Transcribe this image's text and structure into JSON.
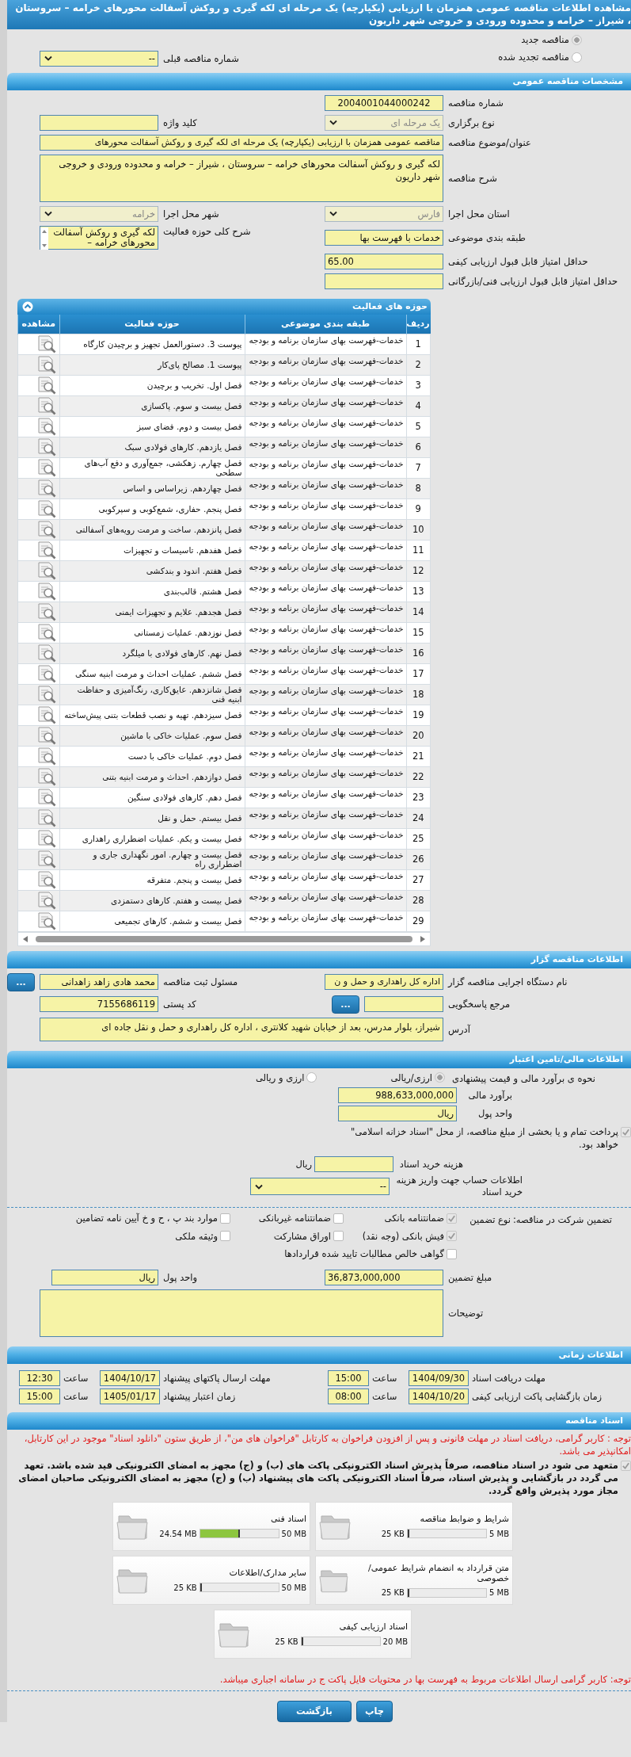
{
  "title": "مشاهده اطلاعات مناقصه عمومی همزمان با ارزیابی (یکپارچه) یک مرحله ای لکه گیری و روکش آسفالت محورهای خرامه – سروستان ، شیراز – خرامه و محدوده ورودی و خروجی شهر داریون",
  "tender_status": {
    "options": [
      {
        "label": "مناقصه جدید",
        "selected": true
      },
      {
        "label": "مناقصه تجدید شده",
        "selected": false
      }
    ],
    "previous_number": {
      "label": "شماره مناقصه قبلی",
      "value": "--",
      "disabled": false
    }
  },
  "general": {
    "heading": "مشخصات مناقصه عمومی",
    "tender_number": {
      "label": "شماره مناقصه",
      "value": "2004001044000242"
    },
    "holding_type": {
      "label": "نوع برگزاری",
      "value": "یک مرحله ای",
      "disabled": true
    },
    "keyword": {
      "label": "کلید واژه"
    },
    "subject": {
      "label": "عنوان/موضوع مناقصه",
      "value": "مناقصه عمومی همزمان با ارزیابی (یکپارچه) یک مرحله ای لکه گیری و روکش آسفالت محورهای"
    },
    "description": {
      "label": "شرح مناقصه",
      "value": "لکه گیری و روکش آسفالت محورهای خرامه – سروستان ، شیراز – خرامه و محدوده ورودی و خروجی شهر داریون"
    },
    "province": {
      "label": "استان محل اجرا",
      "value": "فارس",
      "disabled": true
    },
    "city": {
      "label": "شهر محل اجرا",
      "value": "خرامه",
      "disabled": true
    },
    "category": {
      "label": "طبقه بندی موضوعی",
      "value": "خدمات با فهرست بها"
    },
    "activity_scope": {
      "label": "شرح کلی حوزه فعالیت",
      "value": "لکه گیری و روکش آسفالت محورهای خرامه –"
    },
    "min_quality_score": {
      "label": "حداقل امتیاز قابل قبول ارزیابی کیفی",
      "value": "65.00"
    },
    "min_technical_score": {
      "label": "حداقل امتیاز قابل قبول ارزیابی فنی/بازرگانی"
    }
  },
  "activities": {
    "heading": "حوزه های فعالیت",
    "expanded": true,
    "columns": [
      "ردیف",
      "طبقه بندی موضوعی",
      "حوزه فعالیت",
      "مشاهده"
    ],
    "rows": [
      {
        "row": "1",
        "category": "خدمات-فهرست بهای سازمان برنامه و بودجه",
        "activity": "پیوست 3. دستورالعمل تجهیز و برچیدن کارگاه"
      },
      {
        "row": "2",
        "category": "خدمات-فهرست بهای سازمان برنامه و بودجه",
        "activity": "پیوست 1. مصالح پای‌کار"
      },
      {
        "row": "3",
        "category": "خدمات-فهرست بهای سازمان برنامه و بودجه",
        "activity": "فصل اول. تخریب و برچیدن"
      },
      {
        "row": "4",
        "category": "خدمات-فهرست بهای سازمان برنامه و بودجه",
        "activity": "فصل بیست و سوم. پاکسازی"
      },
      {
        "row": "5",
        "category": "خدمات-فهرست بهای سازمان برنامه و بودجه",
        "activity": "فصل بیست و دوم. فضای سبز"
      },
      {
        "row": "6",
        "category": "خدمات-فهرست بهای سازمان برنامه و بودجه",
        "activity": "فصل یازدهم. کارهای فولادی سبک"
      },
      {
        "row": "7",
        "category": "خدمات-فهرست بهای سازمان برنامه و بودجه",
        "activity": "فصل چهارم. زهکشی، جمع‌آوری و دفع آب‌های سطحی"
      },
      {
        "row": "8",
        "category": "خدمات-فهرست بهای سازمان برنامه و بودجه",
        "activity": "فصل چهاردهم. زیراساس و اساس"
      },
      {
        "row": "9",
        "category": "خدمات-فهرست بهای سازمان برنامه و بودجه",
        "activity": "فصل پنجم. حفاری، شمع‌کوبی و سپرکوبی"
      },
      {
        "row": "10",
        "category": "خدمات-فهرست بهای سازمان برنامه و بودجه",
        "activity": "فصل پانزدهم. ساخت و مرمت رویه‌های آسفالتی"
      },
      {
        "row": "11",
        "category": "خدمات-فهرست بهای سازمان برنامه و بودجه",
        "activity": "فصل هفدهم. تاسیسات و تجهیزات"
      },
      {
        "row": "12",
        "category": "خدمات-فهرست بهای سازمان برنامه و بودجه",
        "activity": "فصل هفتم. اندود و بندکشی"
      },
      {
        "row": "13",
        "category": "خدمات-فهرست بهای سازمان برنامه و بودجه",
        "activity": "فصل هشتم. قالب‌بندی"
      },
      {
        "row": "14",
        "category": "خدمات-فهرست بهای سازمان برنامه و بودجه",
        "activity": "فصل هجدهم. علایم و تجهیزات ایمنی"
      },
      {
        "row": "15",
        "category": "خدمات-فهرست بهای سازمان برنامه و بودجه",
        "activity": "فصل نوزدهم. عملیات زمستانی"
      },
      {
        "row": "16",
        "category": "خدمات-فهرست بهای سازمان برنامه و بودجه",
        "activity": "فصل نهم. کارهای فولادی با میلگرد"
      },
      {
        "row": "17",
        "category": "خدمات-فهرست بهای سازمان برنامه و بودجه",
        "activity": "فصل ششم.  عملیات احداث و مرمت ابنیه سنگی"
      },
      {
        "row": "18",
        "category": "خدمات-فهرست بهای سازمان برنامه و بودجه",
        "activity": "فصل شانزدهم. عایق‌کاری، رنگ‌آمیزی و حفاظت ابنیه فنی"
      },
      {
        "row": "19",
        "category": "خدمات-فهرست بهای سازمان برنامه و بودجه",
        "activity": "فصل سیزدهم. تهیه و نصب قطعات بتنی پیش‌ساخته"
      },
      {
        "row": "20",
        "category": "خدمات-فهرست بهای سازمان برنامه و بودجه",
        "activity": "فصل سوم. عملیات خاکی با ماشین"
      },
      {
        "row": "21",
        "category": "خدمات-فهرست بهای سازمان برنامه و بودجه",
        "activity": "فصل دوم. عملیات خاکی با دست"
      },
      {
        "row": "22",
        "category": "خدمات-فهرست بهای سازمان برنامه و بودجه",
        "activity": "فصل دوازدهم. احداث و مرمت ابنیه بتنی"
      },
      {
        "row": "23",
        "category": "خدمات-فهرست بهای سازمان برنامه و بودجه",
        "activity": "فصل دهم. کارهای فولادی سنگین"
      },
      {
        "row": "24",
        "category": "خدمات-فهرست بهای سازمان برنامه و بودجه",
        "activity": "فصل بیستم. حمل و نقل"
      },
      {
        "row": "25",
        "category": "خدمات-فهرست بهای سازمان برنامه و بودجه",
        "activity": "فصل بیست و یکم. عملیات اضطراری راهداری"
      },
      {
        "row": "26",
        "category": "خدمات-فهرست بهای سازمان برنامه و بودجه",
        "activity": "فصل بیست و چهارم. امور نگهداری جاری و اضطراری راه"
      },
      {
        "row": "27",
        "category": "خدمات-فهرست بهای سازمان برنامه و بودجه",
        "activity": "فصل بیست و پنجم. متفرقه"
      },
      {
        "row": "28",
        "category": "خدمات-فهرست بهای سازمان برنامه و بودجه",
        "activity": "فصل بیست و هفتم. کارهای دستمزدی"
      },
      {
        "row": "29",
        "category": "خدمات-فهرست بهای سازمان برنامه و بودجه",
        "activity": "فصل بیست و ششم. کارهای تجمیعی"
      }
    ]
  },
  "employer": {
    "heading": "اطلاعات مناقصه گزار",
    "executor": {
      "label": "نام دستگاه اجرایی مناقصه گزار",
      "value": "اداره کل راهداری و حمل و ن"
    },
    "registrar": {
      "label": "مسئول ثبت مناقصه",
      "value": "محمد هادی  زاهد زاهدانی",
      "button": "..."
    },
    "reference": {
      "label": "مرجع پاسخگویی",
      "button": "..."
    },
    "postal_code": {
      "label": "کد پستی",
      "value": "7155686119"
    },
    "address": {
      "label": "آدرس",
      "value": "شیراز، بلوار مدرس، بعد از خیابان شهید کلانتری ، اداره کل راهداری و حمل و نقل جاده ای"
    }
  },
  "financial": {
    "heading": "اطلاعات مالی/تامین اعتبار",
    "estimate_method": {
      "label": "نحوه ی برآورد مالی و قیمت پیشنهادی",
      "options": [
        {
          "label": "ارزی/ریالی",
          "selected": true
        },
        {
          "label": "ارزی و ریالی",
          "selected": false
        }
      ]
    },
    "estimate": {
      "label": "برآورد مالی",
      "value": "988,633,000,000"
    },
    "currency": {
      "label": "واحد پول",
      "value": "ریال"
    },
    "treasury_bonds": {
      "label": "پرداخت تمام و یا بخشی از مبلغ مناقصه، از محل \"اسناد خزانه اسلامی\" خواهد بود.",
      "checked": true
    },
    "document_fee": {
      "label": "هزینه خرید اسناد",
      "unit": "ریال"
    },
    "fee_account": {
      "label": "اطلاعات حساب جهت واریز هزینه خرید اسناد",
      "value": "--",
      "disabled": false
    }
  },
  "guarantee": {
    "label": "تضمین شرکت در مناقصه:",
    "type_label": "نوع تضمین",
    "options": [
      {
        "label": "ضمانتنامه بانکی",
        "checked": true
      },
      {
        "label": "ضمانتنامه غیربانکی",
        "checked": false
      },
      {
        "label": "موارد بند پ ، ح و خ آیین نامه تضامین",
        "checked": false
      },
      {
        "label": "فیش بانکی (وجه نقد)",
        "checked": true
      },
      {
        "label": "اوراق مشارکت",
        "checked": false
      },
      {
        "label": "وثیقه ملکی",
        "checked": false
      },
      {
        "label": "گواهی خالص مطالبات تایید شده قراردادها",
        "checked": false
      }
    ],
    "amount": {
      "label": "مبلغ تضمین",
      "value": "36,873,000,000"
    },
    "currency": {
      "label": "واحد پول",
      "value": "ریال"
    },
    "notes": {
      "label": "توضیحات"
    }
  },
  "timing": {
    "heading": "اطلاعات زمانی",
    "items": [
      {
        "label": "مهلت دریافت اسناد",
        "date": "1404/09/30",
        "time_label": "ساعت",
        "time": "15:00"
      },
      {
        "label": "مهلت ارسال پاکتهای پیشنهاد",
        "date": "1404/10/17",
        "time_label": "ساعت",
        "time": "12:30"
      },
      {
        "label": "زمان بازگشایی پاکت ارزیابی کیفی",
        "date": "1404/10/20",
        "time_label": "ساعت",
        "time": "08:00"
      },
      {
        "label": "زمان اعتبار پیشنهاد",
        "date": "1405/01/17",
        "time_label": "ساعت",
        "time": "15:00"
      }
    ]
  },
  "documents": {
    "heading": "اسناد مناقصه",
    "notice": "توجه : کاربر گرامی، دریافت اسناد در مهلت قانونی و پس از افزودن فراخوان به کارتابل \"فراخوان های من\"، از طریق ستون \"دانلود اسناد\" موجود در این کارتابل، امکانپذیر می باشد.",
    "commitment": {
      "label": "متعهد می شود در اسناد مناقصه، صرفاً پذیرش اسناد الکترونیکی پاکت های (ب) و (ج) مجهز به امضای الکترونیکی قید شده باشد. تعهد می گردد در بازگشایی و پذیرش اسناد، صرفاً اسناد الکترونیکی پاکت های پیشنهاد (ب) و (ج) مجهز به امضای الکترونیکی صاحبان امضای مجاز مورد پذیرش واقع گردد.",
      "checked": true
    },
    "files": [
      {
        "name": "شرایط و ضوابط مناقصه",
        "limit": "5 MB",
        "used": "25 KB",
        "level": 0.005
      },
      {
        "name": "اسناد فنی",
        "limit": "50 MB",
        "used": "24.54 MB",
        "level": 0.49
      },
      {
        "name": "متن قرارداد به انضمام شرایط عمومی/خصوصی",
        "limit": "5 MB",
        "used": "25 KB",
        "level": 0.005
      },
      {
        "name": "سایر مدارک/اطلاعات",
        "limit": "50 MB",
        "used": "25 KB",
        "level": 0.0005
      },
      {
        "name": "اسناد ارزیابی کیفی",
        "limit": "20 MB",
        "used": "25 KB",
        "level": 0.001
      }
    ],
    "footer_notice": "توجه: کاربر گرامی ارسال اطلاعات مربوط به فهرست بها در محتویات فایل پاکت ج در سامانه اجباری میباشد."
  },
  "buttons": [
    "چاپ",
    "بازگشت"
  ]
}
